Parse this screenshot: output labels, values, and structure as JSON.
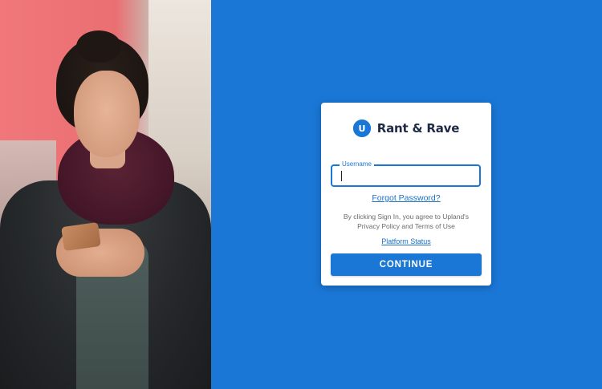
{
  "brand": {
    "name": "Rant & Rave",
    "logo_icon": "upland-u-logo-icon",
    "logo_letter": "U",
    "accent_color": "#1a77d6"
  },
  "hero_image": {
    "icon": "woman-with-phone-photo"
  },
  "login": {
    "username_label": "Username",
    "username_value": "",
    "forgot_password": "Forgot Password?",
    "legal_text": "By clicking Sign In, you agree to Upland's Privacy Policy and Terms of Use",
    "platform_status": "Platform Status",
    "continue_label": "CONTINUE"
  }
}
